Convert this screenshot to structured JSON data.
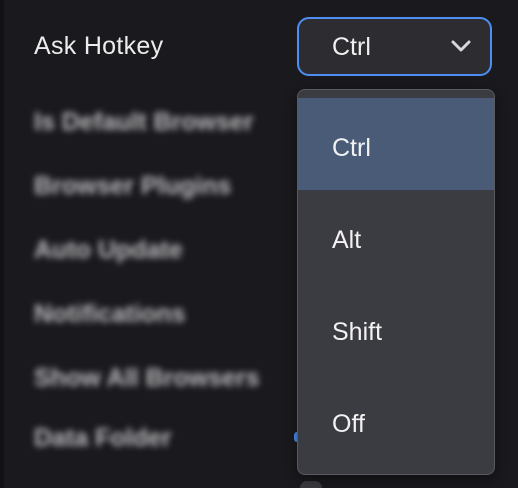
{
  "settings": {
    "ask_hotkey": {
      "label": "Ask Hotkey",
      "value": "Ctrl"
    },
    "rows": [
      {
        "label": "Is Default Browser"
      },
      {
        "label": "Browser Plugins"
      },
      {
        "label": "Auto Update"
      },
      {
        "label": "Notifications"
      },
      {
        "label": "Show All Browsers"
      },
      {
        "label": "Data Folder"
      }
    ]
  },
  "dropdown": {
    "options": [
      "Ctrl",
      "Alt",
      "Shift",
      "Off"
    ],
    "selected": "Ctrl"
  },
  "colors": {
    "background": "#1a1a1e",
    "focus_ring": "#4d8ff0",
    "menu_background": "#3b3b42",
    "selected_option": "#4a5b78"
  },
  "icons": {
    "select_chevron": "chevron-down-icon"
  }
}
